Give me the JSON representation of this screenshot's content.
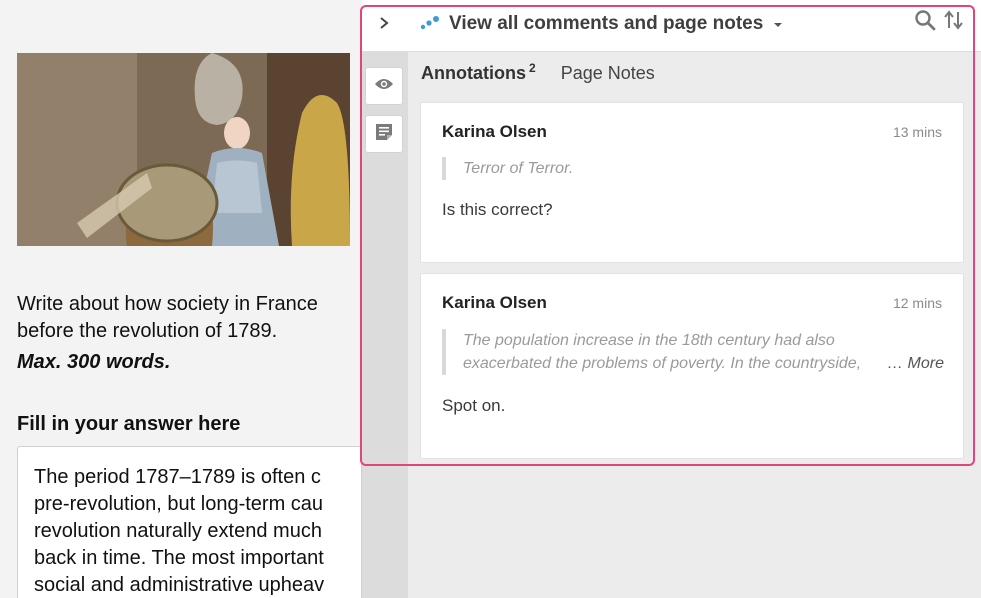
{
  "page": {
    "prompt_lines": [
      "Write about how society in France",
      "before the revolution of 1789."
    ],
    "max_words": "Max. 300 words.",
    "fill_heading": "Fill in your answer here",
    "answer_lines": [
      "The period 1787–1789 is often c",
      "pre-revolution, but long-term cau",
      "revolution naturally extend much",
      "back in time. The most important",
      "social and administrative upheav"
    ]
  },
  "sidebar": {
    "group_label": "View all comments and page notes",
    "tabs": {
      "annotations_label": "Annotations",
      "annotations_count": "2",
      "page_notes_label": "Page Notes"
    },
    "annotations": [
      {
        "author": "Karina Olsen",
        "time": "13 mins",
        "quote_lines": [
          "Terror of Terror."
        ],
        "body": "Is this correct?"
      },
      {
        "author": "Karina Olsen",
        "time": "12 mins",
        "quote_lines": [
          "The population increase in the 18th century had also",
          "exacerbated the problems of poverty. In the countryside,"
        ],
        "more_label": "… More",
        "body": "Spot on."
      }
    ]
  },
  "icons": {
    "collapse": "chevron-right-icon",
    "group": "hypothesis-dots-icon",
    "search": "search-icon",
    "sort": "sort-icon",
    "eye": "eye-icon",
    "note": "note-icon"
  },
  "colors": {
    "highlight_frame": "#e0457b",
    "group_dots": "#3c9ad8"
  }
}
